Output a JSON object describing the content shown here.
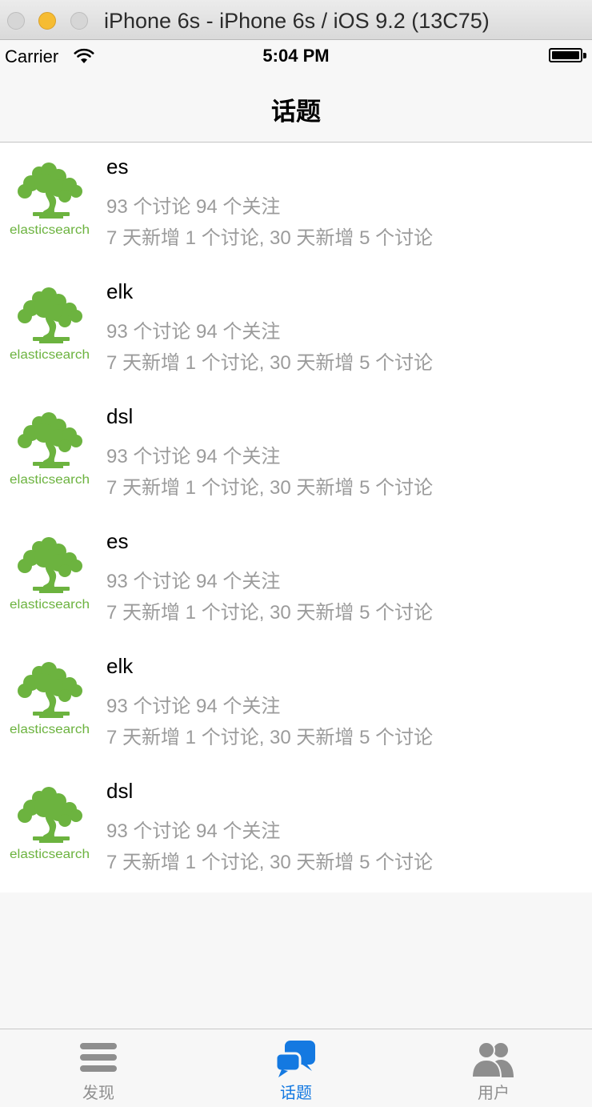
{
  "window": {
    "title": "iPhone 6s - iPhone 6s / iOS 9.2 (13C75)"
  },
  "status_bar": {
    "carrier": "Carrier",
    "time": "5:04 PM"
  },
  "nav": {
    "title": "话题"
  },
  "topics": [
    {
      "name": "es",
      "stats": "93 个讨论 94 个关注",
      "recent": "7 天新增 1 个讨论, 30 天新增 5 个讨论"
    },
    {
      "name": "elk",
      "stats": "93 个讨论 94 个关注",
      "recent": "7 天新增 1 个讨论, 30 天新增 5 个讨论"
    },
    {
      "name": "dsl",
      "stats": "93 个讨论 94 个关注",
      "recent": "7 天新增 1 个讨论, 30 天新增 5 个讨论"
    },
    {
      "name": "es",
      "stats": "93 个讨论 94 个关注",
      "recent": "7 天新增 1 个讨论, 30 天新增 5 个讨论"
    },
    {
      "name": "elk",
      "stats": "93 个讨论 94 个关注",
      "recent": "7 天新增 1 个讨论, 30 天新增 5 个讨论"
    },
    {
      "name": "dsl",
      "stats": "93 个讨论 94 个关注",
      "recent": "7 天新增 1 个讨论, 30 天新增 5 个讨论"
    }
  ],
  "logo": {
    "text": "elasticsearch",
    "color": "#6cb33f"
  },
  "tabs": [
    {
      "label": "发现",
      "icon": "menu-icon",
      "active": false
    },
    {
      "label": "话题",
      "icon": "chat-icon",
      "active": true
    },
    {
      "label": "用户",
      "icon": "users-icon",
      "active": false
    }
  ],
  "colors": {
    "accent": "#1479e1",
    "inactive": "#8e8e8e",
    "secondary_text": "#9b9b9b",
    "background": "#f7f7f7"
  }
}
